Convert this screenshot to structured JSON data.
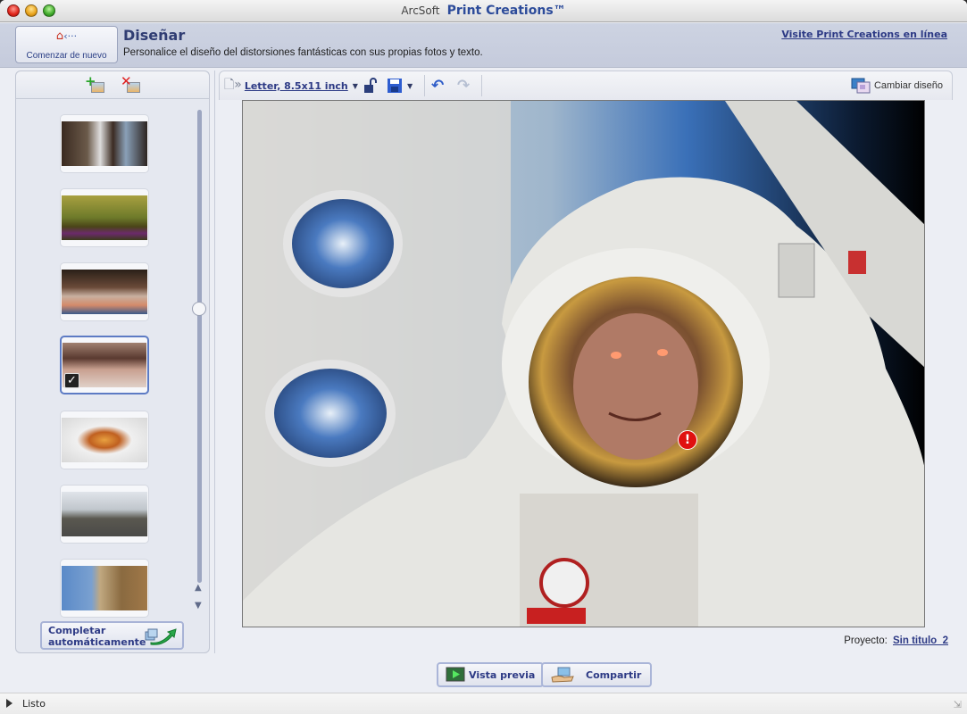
{
  "window": {
    "brand": "ArcSoft",
    "product": "Print Creations™"
  },
  "header": {
    "home_button_label": "Comenzar de nuevo",
    "title": "Diseñar",
    "subtitle": "Personalice el diseño del distorsiones fantásticas con sus propias fotos y texto.",
    "online_link": "Visite Print Creations en línea"
  },
  "left_panel": {
    "add_photo_icon": "add-photo-icon",
    "remove_photo_icon": "remove-photo-icon",
    "thumbnails": [
      {
        "subject": "group of people in room",
        "selected": false
      },
      {
        "subject": "computer desk",
        "selected": false
      },
      {
        "subject": "people at dinner table",
        "selected": false
      },
      {
        "subject": "crowd at party",
        "selected": true
      },
      {
        "subject": "plate of food",
        "selected": false
      },
      {
        "subject": "street with tree",
        "selected": false
      },
      {
        "subject": "building facade",
        "selected": false
      }
    ],
    "auto_fill_label_1": "Completar",
    "auto_fill_label_2": "automáticamente"
  },
  "toolbar": {
    "page_size": "Letter, 8.5x11 inch",
    "change_design": "Cambiar diseño"
  },
  "canvas": {
    "description": "Astronaut in spacesuit with face composited into helmet visor",
    "warning_icon": "exclamation"
  },
  "footer": {
    "project_label": "Proyecto:",
    "project_name": "Sin titulo_2",
    "preview_button": "Vista previa",
    "share_button": "Compartir"
  },
  "status": {
    "text": "Listo"
  }
}
